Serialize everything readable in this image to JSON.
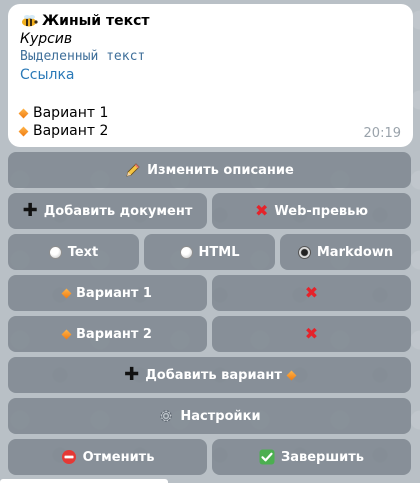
{
  "message": {
    "title": "Жиный текст",
    "italic": "Курсив",
    "highlighted": "Выделенный текст",
    "link": "Ссылка",
    "options": [
      "Вариант 1",
      "Вариант 2"
    ],
    "time": "20:19",
    "title_icon": "bee-icon"
  },
  "keyboard": {
    "edit_description": "Изменить описание",
    "add_document": "Добавить документ",
    "web_preview": "Web-превью",
    "format_text": "Text",
    "format_html": "HTML",
    "format_markdown": "Markdown",
    "selected_format": "Markdown",
    "option_1": "Вариант 1",
    "option_2": "Вариант 2",
    "add_option": "Добавить вариант",
    "settings": "Настройки",
    "cancel": "Отменить",
    "finish": "Завершить"
  },
  "colors": {
    "button_bg": "#7e878e",
    "link": "#2b7ab8",
    "red_x": "#e5232a",
    "check_green": "#4caf50",
    "diamond_orange": "#f28c1a"
  }
}
